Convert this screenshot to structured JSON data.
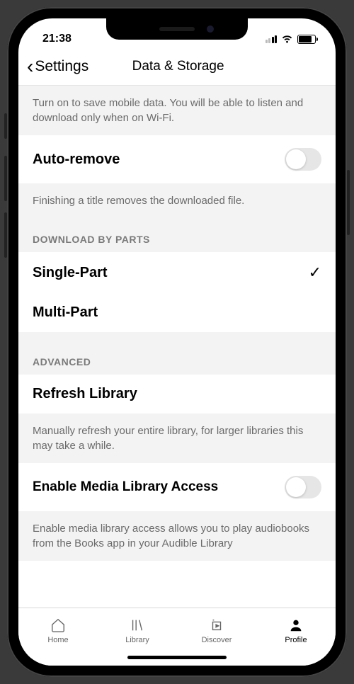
{
  "status": {
    "time": "21:38"
  },
  "nav": {
    "back_label": "Settings",
    "title": "Data & Storage"
  },
  "wifi_only_desc": "Turn on to save mobile data. You will be able to listen and download only when on Wi-Fi.",
  "auto_remove": {
    "label": "Auto-remove",
    "desc": "Finishing a title removes the downloaded file."
  },
  "download_parts": {
    "header": "DOWNLOAD BY PARTS",
    "options": [
      {
        "label": "Single-Part",
        "selected": true
      },
      {
        "label": "Multi-Part",
        "selected": false
      }
    ]
  },
  "advanced": {
    "header": "ADVANCED",
    "refresh_label": "Refresh Library",
    "refresh_desc": "Manually refresh your entire library, for larger libraries this may take a while.",
    "media_access_label": "Enable Media Library Access",
    "media_access_desc": "Enable media library access allows you to play audiobooks from the Books app in your Audible Library"
  },
  "tabs": {
    "home": "Home",
    "library": "Library",
    "discover": "Discover",
    "profile": "Profile"
  }
}
